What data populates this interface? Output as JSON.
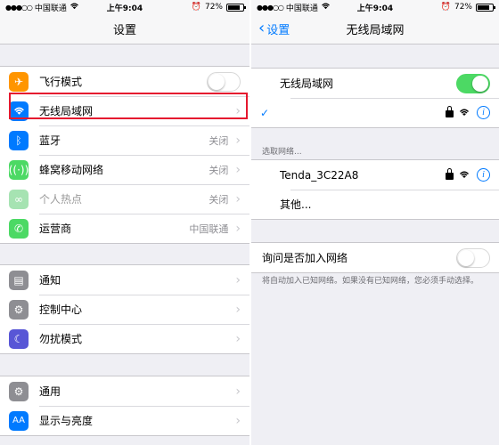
{
  "left": {
    "status": {
      "carrier": "中国联通",
      "time": "上午9:04",
      "battery": "72%"
    },
    "nav_title": "设置",
    "groups": [
      [
        {
          "label": "飞行模式",
          "icon": "airplane-icon",
          "color": "#ff9500",
          "type": "toggle",
          "on": false
        },
        {
          "label": "无线局域网",
          "icon": "wifi-icon",
          "color": "#007aff",
          "type": "chevron",
          "value": ""
        },
        {
          "label": "蓝牙",
          "icon": "bluetooth-icon",
          "color": "#007aff",
          "type": "chevron",
          "value": "关闭"
        },
        {
          "label": "蜂窝移动网络",
          "icon": "cellular-icon",
          "color": "#4cd964",
          "type": "chevron",
          "value": "关闭"
        },
        {
          "label": "个人热点",
          "icon": "hotspot-icon",
          "color": "#4cd964",
          "type": "chevron",
          "value": "关闭",
          "dim": true
        },
        {
          "label": "运营商",
          "icon": "phone-icon",
          "color": "#4cd964",
          "type": "chevron",
          "value": "中国联通"
        }
      ],
      [
        {
          "label": "通知",
          "icon": "notification-icon",
          "color": "#8e8e93",
          "type": "chevron",
          "value": ""
        },
        {
          "label": "控制中心",
          "icon": "control-center-icon",
          "color": "#8e8e93",
          "type": "chevron",
          "value": ""
        },
        {
          "label": "勿扰模式",
          "icon": "moon-icon",
          "color": "#5856d6",
          "type": "chevron",
          "value": ""
        }
      ],
      [
        {
          "label": "通用",
          "icon": "gear-icon",
          "color": "#8e8e93",
          "type": "chevron",
          "value": ""
        },
        {
          "label": "显示与亮度",
          "icon": "display-icon",
          "color": "#007aff",
          "type": "chevron",
          "value": ""
        }
      ]
    ]
  },
  "right": {
    "status": {
      "carrier": "中国联通",
      "time": "上午9:04",
      "battery": "72%"
    },
    "back_label": "设置",
    "nav_title": "无线局域网",
    "wifi_label": "无线局域网",
    "wifi_on": true,
    "choose_network_label": "选取网络...",
    "networks": [
      {
        "name": "Tenda_3C22A8"
      }
    ],
    "other_label": "其他...",
    "ask_join_label": "询问是否加入网络",
    "ask_join_on": false,
    "ask_join_note": "将自动加入已知网络。如果没有已知网络，您必须手动选择。"
  }
}
